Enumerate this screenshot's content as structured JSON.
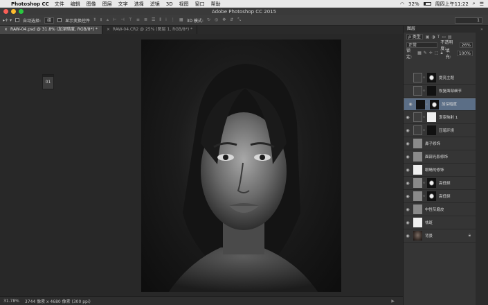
{
  "menubar": {
    "app_name": "Photoshop CC",
    "items": [
      "文件",
      "编辑",
      "图像",
      "图层",
      "文字",
      "选择",
      "滤镜",
      "3D",
      "视图",
      "窗口",
      "帮助"
    ],
    "battery": "32%",
    "clock": "周四上午11:22"
  },
  "titlebar": {
    "title": "Adobe Photoshop CC 2015"
  },
  "options": {
    "auto_select_label": "自动选择:",
    "auto_select_value": "组",
    "show_transform_label": "显示变换控件",
    "mode_3d_label": "3D 模式:",
    "workspace_value": "1"
  },
  "tabs": [
    {
      "label": "RAW-04.psd @ 31.8% (加深暗度, RGB/8*) *",
      "active": true
    },
    {
      "label": "RAW-04.CR2 @ 25% (图层 1, RGB/8*) *",
      "active": false
    }
  ],
  "mini_panel": {
    "label": "01"
  },
  "status": {
    "zoom": "31.78%",
    "doc_info": "3744 像素 x 4680 像素 (300 ppi)"
  },
  "layers_panel": {
    "title": "图层",
    "filter_label": "ρ 类型",
    "blend_mode": "正常",
    "opacity_label": "不透明度:",
    "opacity_value": "26%",
    "lock_label": "锁定:",
    "fill_label": "填充:",
    "fill_value": "100%",
    "layers": [
      {
        "name": "提亮主题",
        "visible": false,
        "thumb": "adj",
        "mask": "mask",
        "selected": false
      },
      {
        "name": "恢复面部细节",
        "visible": false,
        "thumb": "adj",
        "mask": "black",
        "selected": false
      },
      {
        "name": "加深暗度",
        "visible": true,
        "thumb": "black",
        "mask": "mask",
        "selected": true
      },
      {
        "name": "渐变映射 1",
        "visible": true,
        "thumb": "adj",
        "mask": "white",
        "selected": false
      },
      {
        "name": "压暗环境",
        "visible": true,
        "thumb": "adj",
        "mask": "black",
        "selected": false
      },
      {
        "name": "鼻子修饰",
        "visible": true,
        "thumb": "gray",
        "mask": "",
        "selected": false
      },
      {
        "name": "面部光影修饰",
        "visible": true,
        "thumb": "gray",
        "mask": "",
        "selected": false
      },
      {
        "name": "眼睛的修饰",
        "visible": true,
        "thumb": "white",
        "mask": "",
        "selected": false
      },
      {
        "name": "高低频",
        "visible": true,
        "thumb": "gray",
        "mask": "mask",
        "selected": false
      },
      {
        "name": "高低频",
        "visible": true,
        "thumb": "gray",
        "mask": "mask",
        "selected": false
      },
      {
        "name": "中性灰磨皮",
        "visible": true,
        "thumb": "gray",
        "mask": "",
        "selected": false
      },
      {
        "name": "祛斑",
        "visible": true,
        "thumb": "white",
        "mask": "",
        "selected": false
      },
      {
        "name": "背景",
        "visible": true,
        "thumb": "photo",
        "mask": "",
        "selected": false,
        "locked": true
      }
    ]
  }
}
